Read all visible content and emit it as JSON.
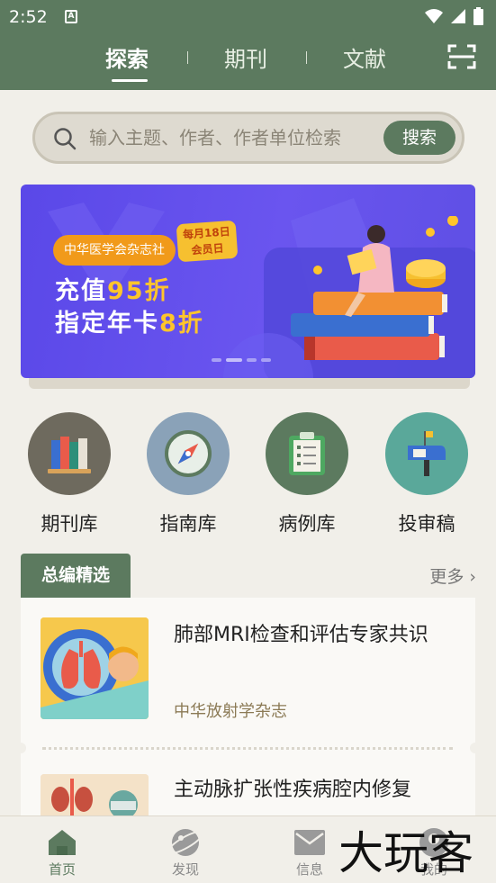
{
  "status_bar": {
    "time": "2:52",
    "a_icon": "A"
  },
  "header": {
    "tabs": [
      {
        "label": "探索",
        "active": true
      },
      {
        "label": "期刊",
        "active": false
      },
      {
        "label": "文献",
        "active": false
      }
    ],
    "scan_icon": "scan-icon"
  },
  "search": {
    "placeholder": "输入主题、作者、作者单位检索",
    "button_label": "搜索"
  },
  "banner": {
    "publisher": "中华医学会杂志社",
    "tag_line1": "每月18日",
    "tag_line2": "会员日",
    "line1_prefix": "充值",
    "line1_highlight": "95折",
    "line2_prefix": "指定年卡",
    "line2_highlight": "8折",
    "pages": 4,
    "active_page": 2
  },
  "categories": [
    {
      "label": "期刊库",
      "icon": "books-icon",
      "color": "#6e6a5e"
    },
    {
      "label": "指南库",
      "icon": "compass-icon",
      "color": "#8aa2b8"
    },
    {
      "label": "病例库",
      "icon": "clipboard-icon",
      "color": "#5c7a5f"
    },
    {
      "label": "投审稿",
      "icon": "mailbox-icon",
      "color": "#5aa89a"
    }
  ],
  "section": {
    "title": "总编精选",
    "more_label": "更多"
  },
  "articles": [
    {
      "title": "肺部MRI检查和评估专家共识",
      "source": "中华放射学杂志"
    },
    {
      "title": "主动脉扩张性疾病腔内修复",
      "source": ""
    }
  ],
  "bottom_nav": [
    {
      "label": "首页",
      "icon": "home-icon",
      "active": true
    },
    {
      "label": "发现",
      "icon": "discover-icon",
      "active": false
    },
    {
      "label": "信息",
      "icon": "mail-icon",
      "active": false
    },
    {
      "label": "我的",
      "icon": "profile-icon",
      "active": false
    }
  ],
  "watermark": "大玩客",
  "colors": {
    "primary": "#5c7a5f",
    "background": "#f1efe9",
    "banner": "#5a48e8",
    "accent": "#ffc52b"
  }
}
